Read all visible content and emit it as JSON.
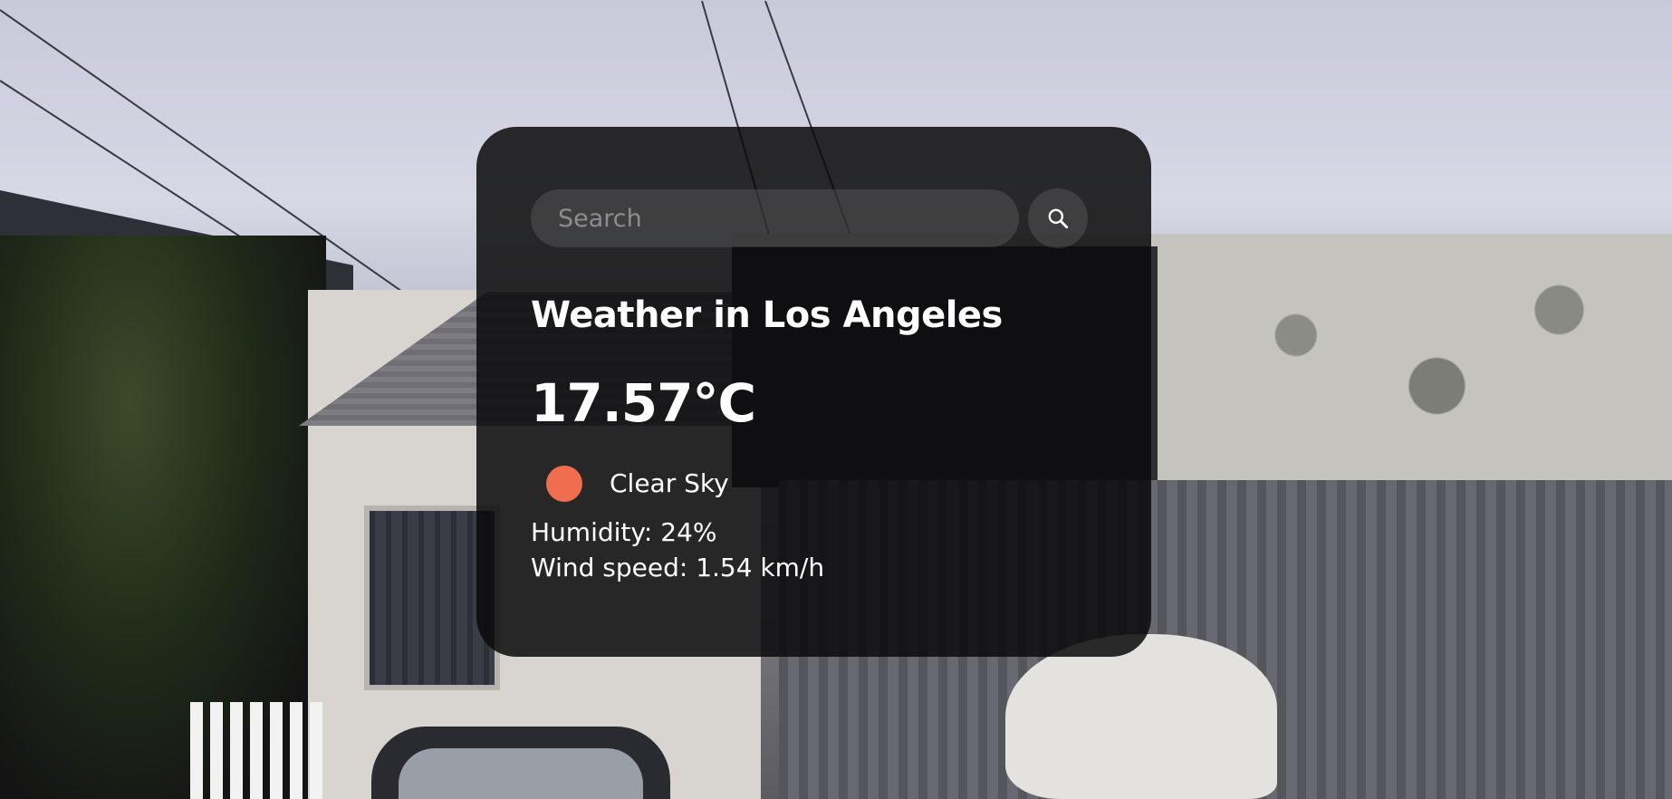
{
  "search": {
    "placeholder": "Search",
    "value": "",
    "button_icon": "search-icon"
  },
  "weather": {
    "title": "Weather in Los Angeles",
    "temperature": "17.57°C",
    "condition": {
      "label": "Clear Sky",
      "icon": "sun-icon",
      "icon_color": "#f06d4f"
    },
    "humidity": "Humidity: 24%",
    "wind_speed": "Wind speed: 1.54 km/h"
  },
  "theme": {
    "card_background": "rgba(10,10,12,0.86)",
    "text_color": "#ffffff",
    "input_background": "rgba(125,125,128,0.28)"
  }
}
